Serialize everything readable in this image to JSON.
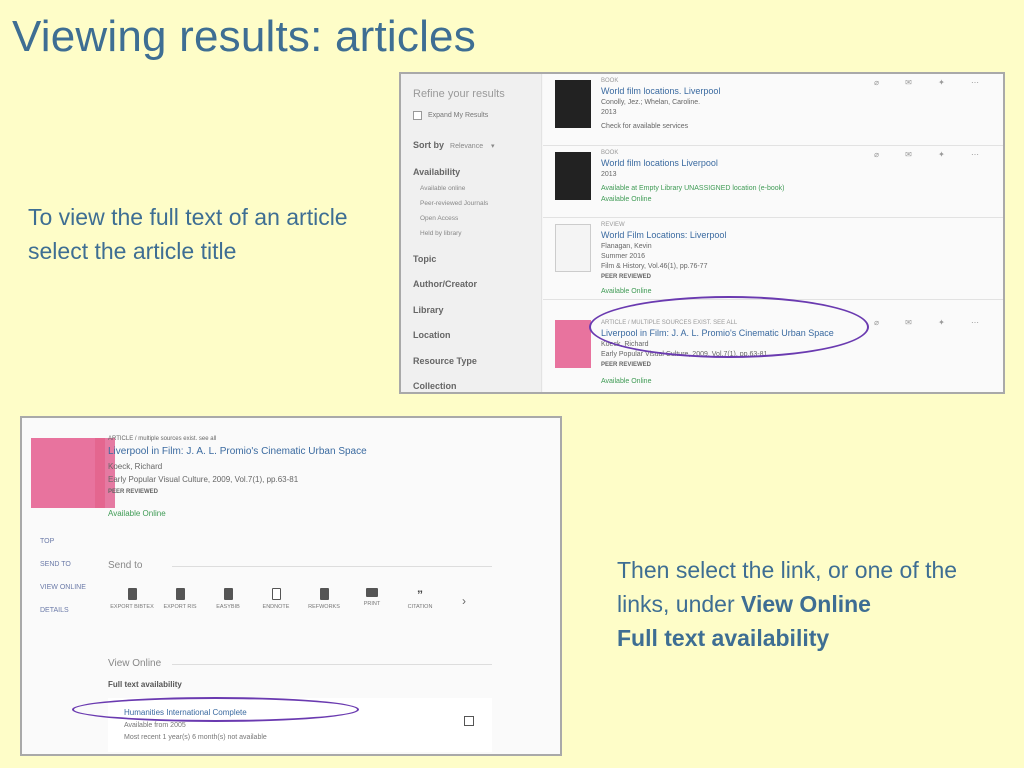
{
  "slide": {
    "title": "Viewing results: articles",
    "caption1": "To view the full text of an article select the article title",
    "caption2_pre": "Then select the link, or one of the links, under ",
    "caption2_bold1": "View Online",
    "caption2_bold2": "Full text availability"
  },
  "shot1": {
    "refine_title": "Refine your results",
    "expand": "Expand My Results",
    "sort_label": "Sort by",
    "sort_value": "Relevance",
    "facets": [
      "Availability",
      "Topic",
      "Author/Creator",
      "Library",
      "Location",
      "Resource Type",
      "Collection"
    ],
    "availability_subs": [
      "Available online",
      "Peer-reviewed Journals",
      "Open Access",
      "Held by library"
    ],
    "records": [
      {
        "type": "Book",
        "title": "World film locations. Liverpool",
        "l1": "Conolly, Jez.; Whelan, Caroline.",
        "l2": "2013",
        "l3": "Check for available services"
      },
      {
        "type": "Book",
        "title": "World film locations Liverpool",
        "l1": "2013",
        "l2": "Available at Empty Library  UNASSIGNED location (e-book)",
        "l3": "Available Online"
      },
      {
        "type": "Review",
        "title": "World Film Locations: Liverpool",
        "l1": "Flanagan, Kevin",
        "l2": "Summer 2016",
        "l3": "Film & History, Vol.46(1), pp.76-77",
        "peer": "PEER REVIEWED",
        "avail": "Available Online"
      },
      {
        "type": "Article / multiple sources exist. see all",
        "title": "Liverpool in Film: J. A. L. Promio's Cinematic Urban Space",
        "l1": "Koeck, Richard",
        "l2": "Early Popular Visual Culture, 2009, Vol.7(1), pp.63-81",
        "peer": "PEER REVIEWED",
        "avail": "Available Online"
      }
    ]
  },
  "shot2": {
    "type": "ARTICLE / multiple sources exist. see all",
    "title": "Liverpool in Film: J. A. L. Promio's Cinematic Urban Space",
    "author": "Koeck, Richard",
    "source": "Early Popular Visual Culture, 2009, Vol.7(1), pp.63-81",
    "peer": "PEER REVIEWED",
    "avail": "Available Online",
    "nav": [
      "TOP",
      "SEND TO",
      "VIEW ONLINE",
      "DETAILS"
    ],
    "send_to": "Send to",
    "send_buttons": [
      "EXPORT BIBTEX",
      "EXPORT RIS",
      "EASYBIB",
      "ENDNOTE",
      "REFWORKS",
      "PRINT",
      "CITATION"
    ],
    "view_online": "View Online",
    "full_text": "Full text availability",
    "ft_link": "Humanities International Complete",
    "ft_from": "Available from 2005",
    "ft_recent": "Most recent 1 year(s) 6 month(s) not available"
  },
  "colors": {
    "background": "#fefdc8",
    "title": "#3e6e93",
    "highlight_ellipse": "#6a3ab0"
  }
}
